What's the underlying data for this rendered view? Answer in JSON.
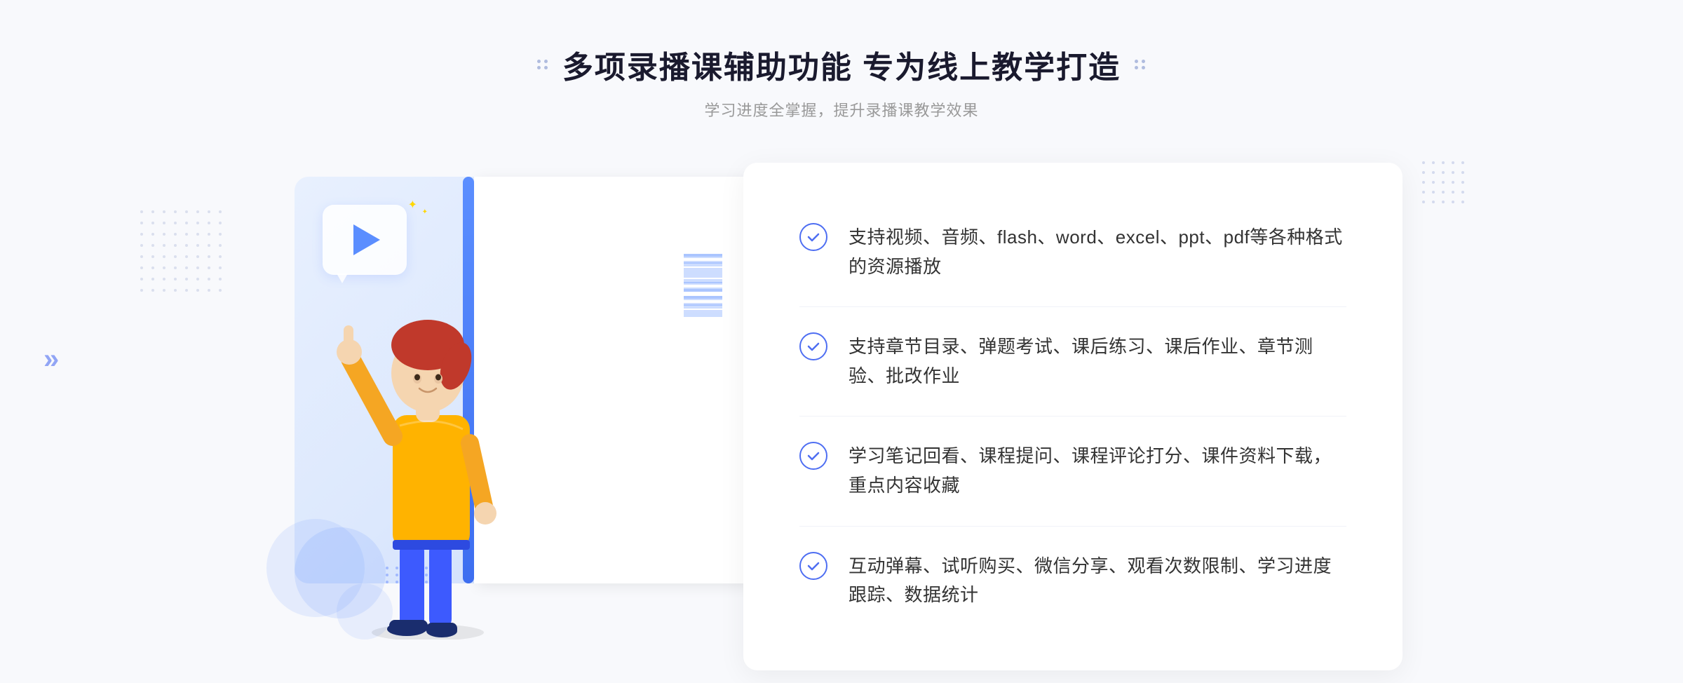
{
  "page": {
    "background": "#f8f9fc"
  },
  "header": {
    "title": "多项录播课辅助功能 专为线上教学打造",
    "subtitle": "学习进度全掌握，提升录播课教学效果"
  },
  "features": [
    {
      "id": "feature-1",
      "text": "支持视频、音频、flash、word、excel、ppt、pdf等各种格式的资源播放"
    },
    {
      "id": "feature-2",
      "text": "支持章节目录、弹题考试、课后练习、课后作业、章节测验、批改作业"
    },
    {
      "id": "feature-3",
      "text": "学习笔记回看、课程提问、课程评论打分、课件资料下载，重点内容收藏"
    },
    {
      "id": "feature-4",
      "text": "互动弹幕、试听购买、微信分享、观看次数限制、学习进度跟踪、数据统计"
    }
  ],
  "decorators": {
    "title_left": "«",
    "title_right": "»",
    "chevron": "»"
  }
}
